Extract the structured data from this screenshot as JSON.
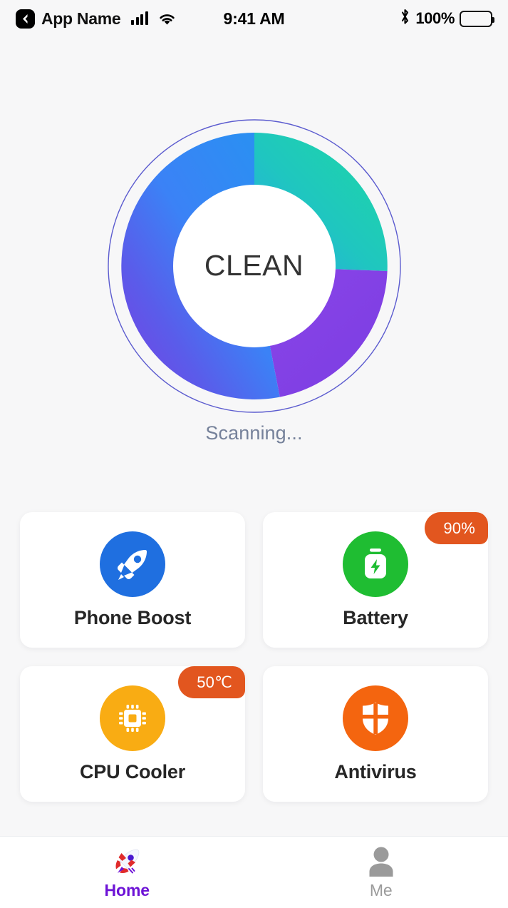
{
  "status_bar": {
    "back_icon": "chevron-left-icon",
    "app_name": "App Name",
    "signal_icon": "signal-bars-icon",
    "wifi_icon": "wifi-icon",
    "time": "9:41 AM",
    "bluetooth_icon": "bluetooth-icon",
    "battery_percent": "100%",
    "battery_icon": "battery-full-icon"
  },
  "gauge": {
    "center_label": "CLEAN",
    "status_text": "Scanning...",
    "outer_ring_color": "#4040c8",
    "segments": [
      {
        "name": "storage",
        "color_start": "#27d8a4",
        "color_end": "#17c3a0",
        "percent": 25
      },
      {
        "name": "memory",
        "color_start": "#8a44e6",
        "color_end": "#7b3fe4",
        "percent": 17
      },
      {
        "name": "clean",
        "color_start": "#6f4bea",
        "color_end": "#2d8cf5",
        "percent": 58
      }
    ]
  },
  "features": [
    {
      "id": "phone-boost",
      "label": "Phone Boost",
      "icon": "rocket-icon",
      "icon_bg": "#1f6fe0",
      "badge": null
    },
    {
      "id": "battery",
      "label": "Battery",
      "icon": "battery-bolt-icon",
      "icon_bg": "#1fbd32",
      "badge": "90%"
    },
    {
      "id": "cpu-cooler",
      "label": "CPU Cooler",
      "icon": "cpu-chip-icon",
      "icon_bg": "#f9ac13",
      "badge": "50℃"
    },
    {
      "id": "antivirus",
      "label": "Antivirus",
      "icon": "shield-icon",
      "icon_bg": "#f4650f",
      "badge": null
    }
  ],
  "tabbar": {
    "badge_color": "#e2561f",
    "items": [
      {
        "id": "home",
        "label": "Home",
        "icon": "rocket-emoji-icon",
        "active": true,
        "color": "#6d13d6"
      },
      {
        "id": "me",
        "label": "Me",
        "icon": "person-icon",
        "active": false,
        "color": "#9a9a9a"
      }
    ]
  }
}
